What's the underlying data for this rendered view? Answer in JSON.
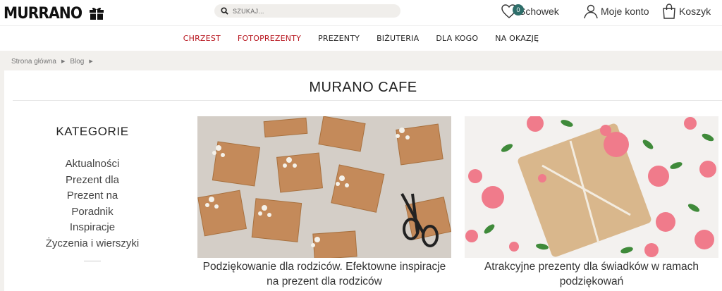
{
  "header": {
    "logo_text": "MURRANO",
    "logo_icon": "gift-icon",
    "search_placeholder": "SZUKAJ...",
    "wishlist_label": "Schowek",
    "wishlist_count": "0",
    "account_label": "Moje konto",
    "cart_label": "Koszyk"
  },
  "nav": {
    "items": [
      "CHRZEST",
      "FOTOPREZENTY",
      "PREZENTY",
      "BIŻUTERIA",
      "DLA KOGO",
      "NA OKAZJĘ"
    ],
    "highlight_color": "#b8161f"
  },
  "breadcrumb": [
    "Strona główna",
    "Blog"
  ],
  "page": {
    "title": "MURANO CAFE"
  },
  "sidebar": {
    "title": "KATEGORIE",
    "items": [
      "Aktualności",
      "Prezent dla",
      "Prezent na",
      "Poradnik",
      "Inspiracje",
      "Życzenia i wierszyki"
    ]
  },
  "posts": [
    {
      "title": "Podziękowanie dla rodziców. Efektowne inspiracje na prezent dla rodziców"
    },
    {
      "title": "Atrakcyjne prezenty dla świadków w ramach podziękowań"
    }
  ],
  "colors": {
    "badge": "#2e6e6a",
    "page_bg": "#f2f0ed"
  }
}
